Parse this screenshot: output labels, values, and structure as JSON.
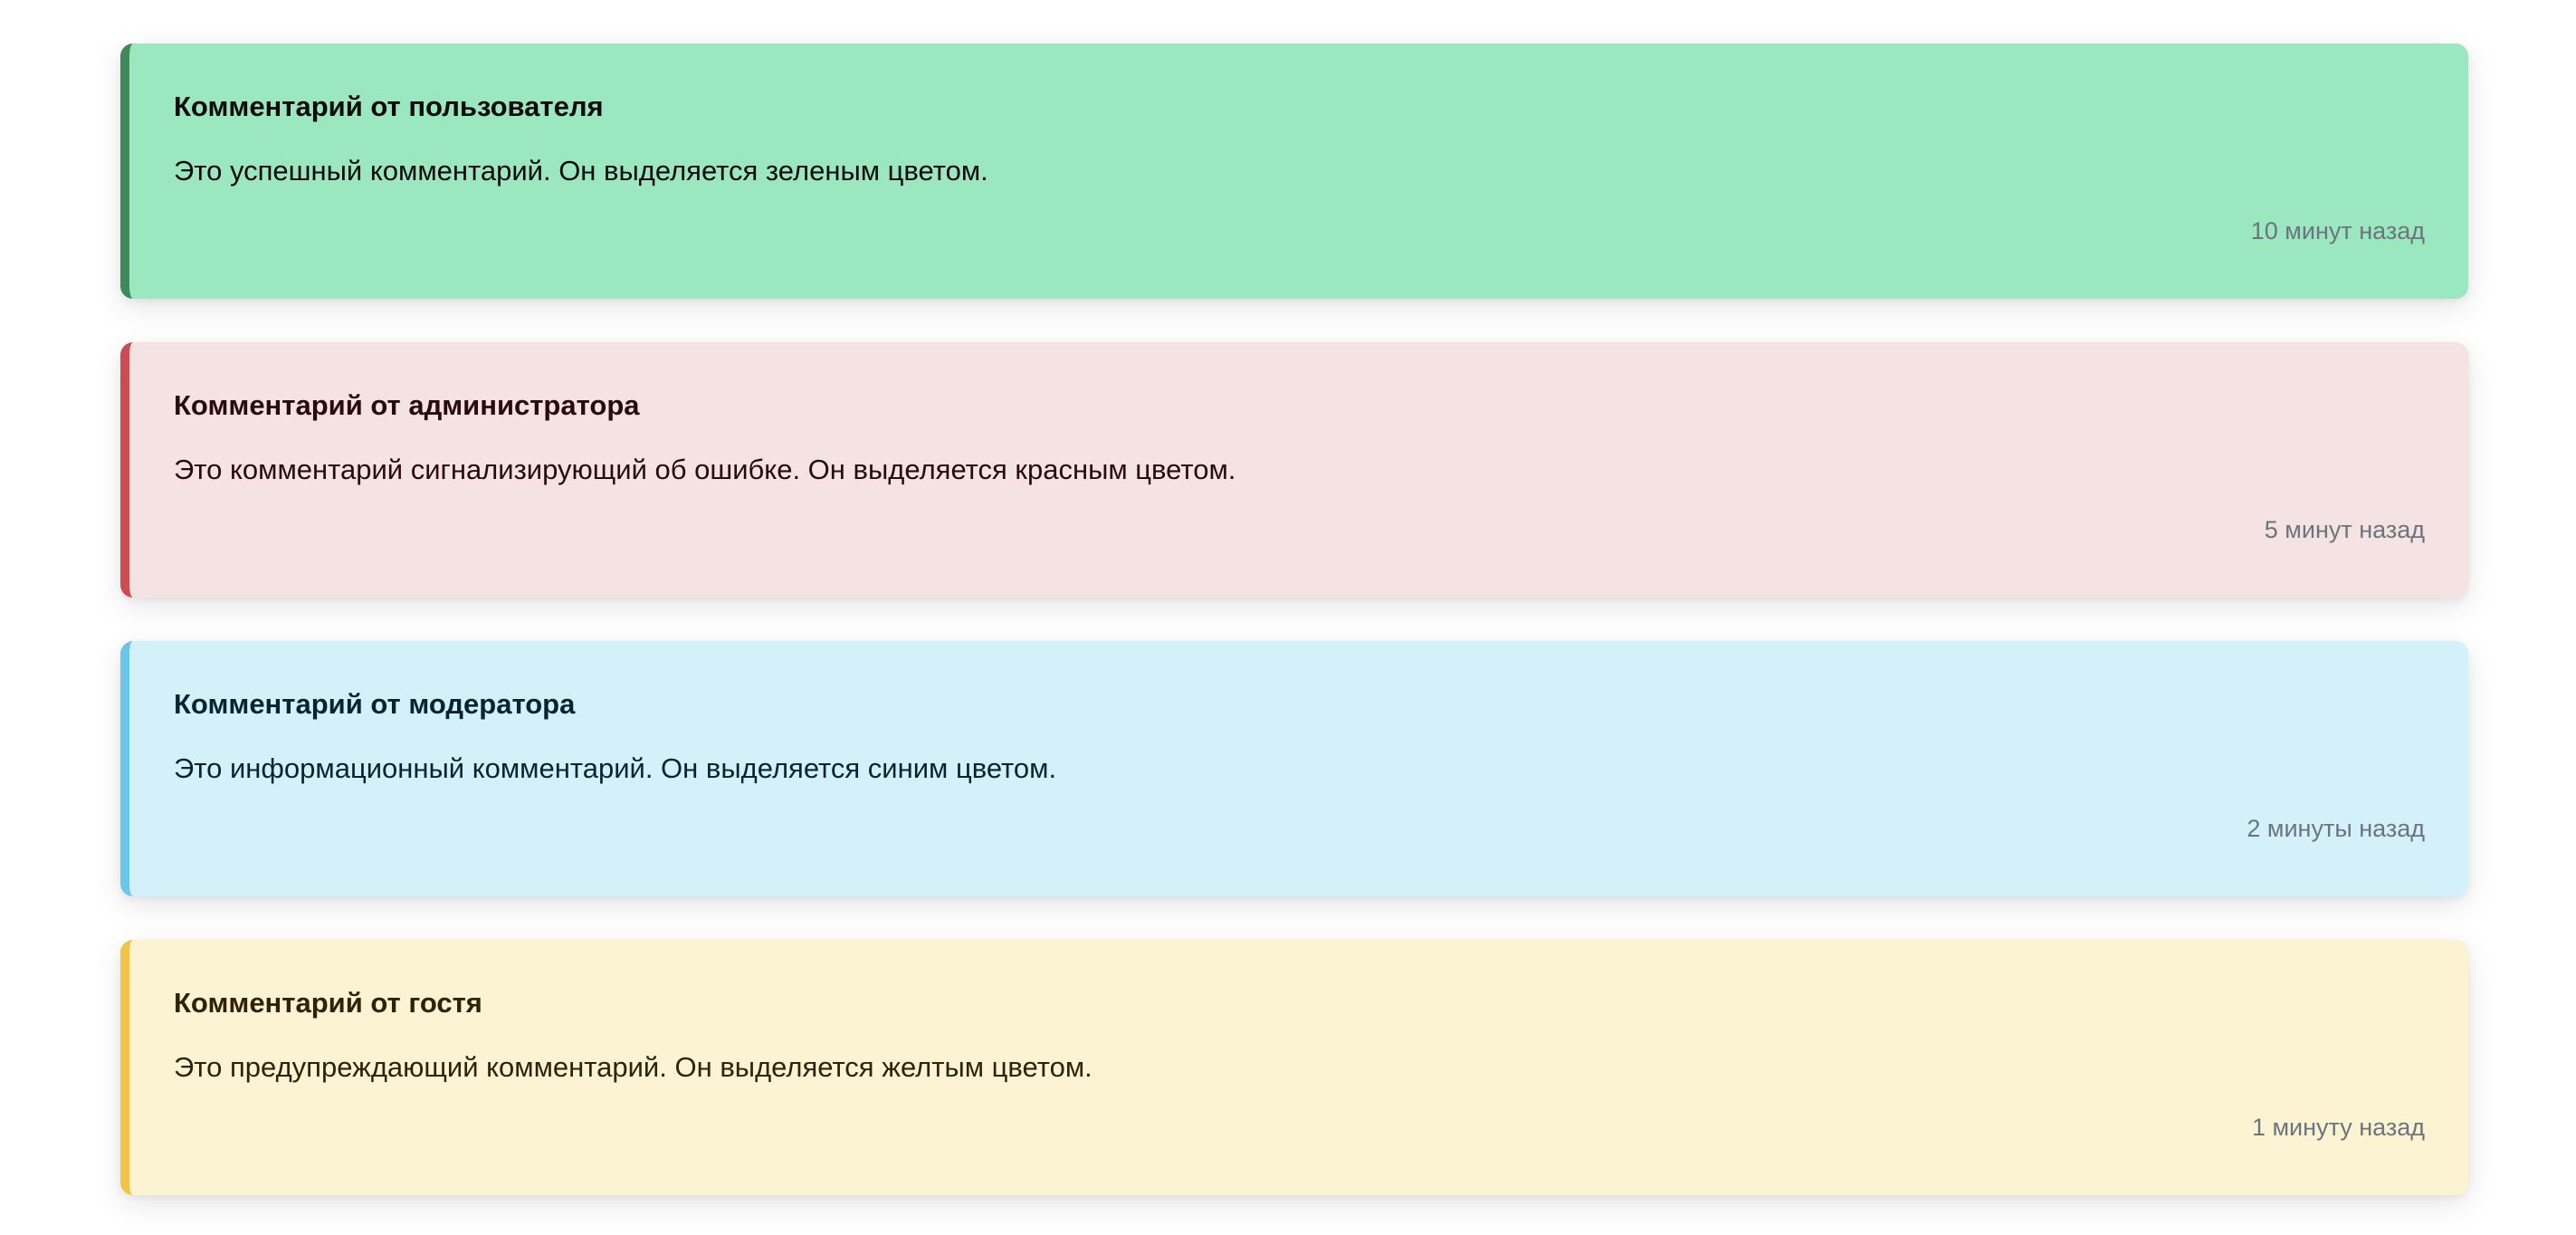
{
  "comments": [
    {
      "title": "Комментарий от пользователя",
      "text": "Это успешный комментарий. Он выделяется зеленым цветом.",
      "time": "10 минут назад",
      "variant": "success",
      "background": "#9be7bf",
      "border": "#3f8a5a",
      "text_color": "#0b0b0b"
    },
    {
      "title": "Комментарий от администратора",
      "text": "Это комментарий сигнализирующий об ошибке. Он выделяется красным цветом.",
      "time": "5 минут назад",
      "variant": "danger",
      "background": "#f5e3e3",
      "border": "#cf4b52",
      "text_color": "#2a0a0c"
    },
    {
      "title": "Комментарий от модератора",
      "text": "Это информационный комментарий. Он выделяется синим цветом.",
      "time": "2 минуты назад",
      "variant": "info",
      "background": "#d4f1f9",
      "border": "#6bc7e8",
      "text_color": "#0a2330"
    },
    {
      "title": "Комментарий от гостя",
      "text": "Это предупреждающий комментарий. Он выделяется желтым цветом.",
      "time": "1 минуту назад",
      "variant": "warning",
      "background": "#fcf3d3",
      "border": "#f2c443",
      "text_color": "#2e2305"
    }
  ],
  "time_color": "#6c757d"
}
